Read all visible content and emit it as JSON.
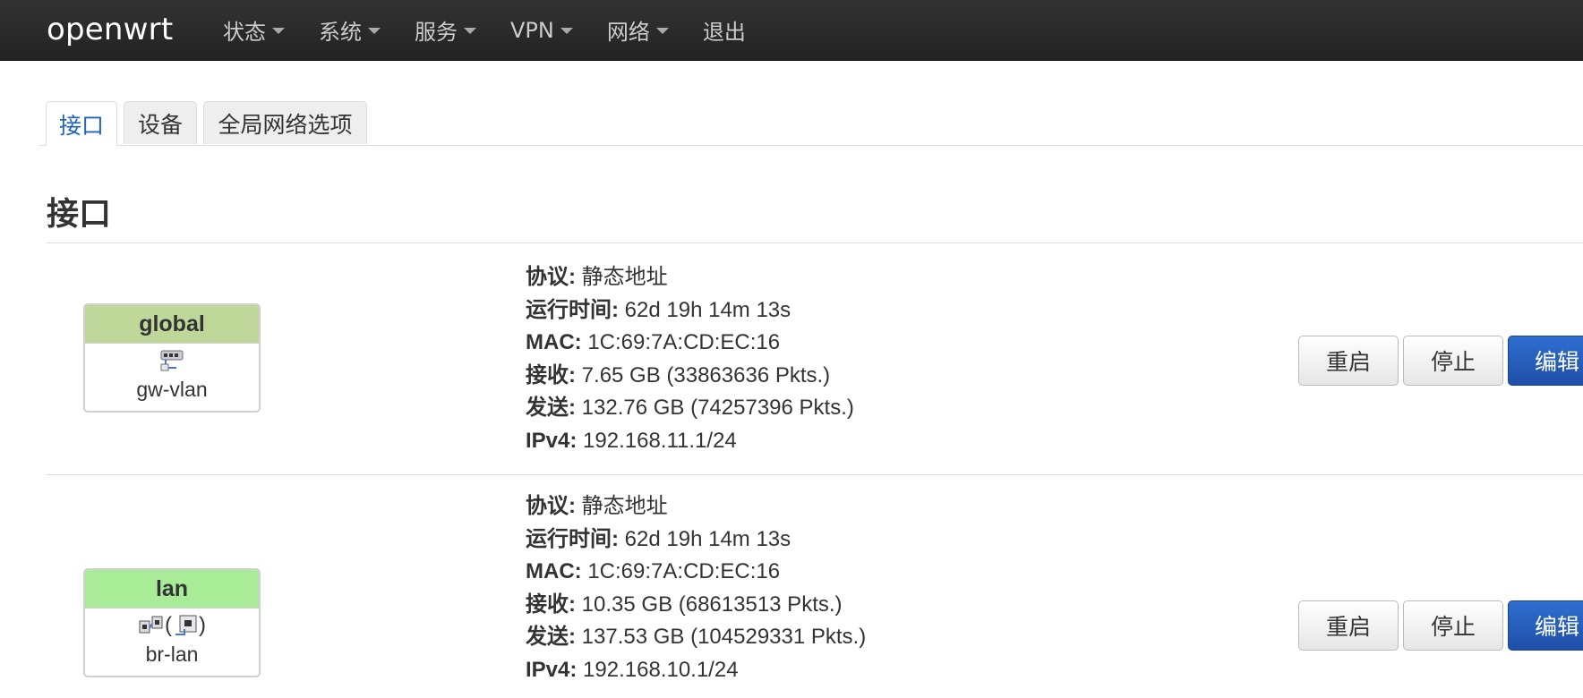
{
  "app": {
    "brand": "openwrt"
  },
  "nav": {
    "items": [
      {
        "label": "状态",
        "dropdown": true
      },
      {
        "label": "系统",
        "dropdown": true
      },
      {
        "label": "服务",
        "dropdown": true
      },
      {
        "label": "VPN",
        "dropdown": true
      },
      {
        "label": "网络",
        "dropdown": true
      },
      {
        "label": "退出",
        "dropdown": false
      }
    ]
  },
  "tabs": [
    {
      "label": "接口",
      "active": true
    },
    {
      "label": "设备",
      "active": false
    },
    {
      "label": "全局网络选项",
      "active": false
    }
  ],
  "section": {
    "title": "接口"
  },
  "interfaces": [
    {
      "name": "global",
      "header_color": "#bfd89a",
      "device": "gw-vlan",
      "icons": [
        "switch-port-icon"
      ],
      "protocol_label": "协议:",
      "protocol": "静态地址",
      "uptime_label": "运行时间:",
      "uptime": "62d 19h 14m 13s",
      "mac_label": "MAC:",
      "mac": "1C:69:7A:CD:EC:16",
      "rx_label": "接收:",
      "rx": "7.65 GB (33863636 Pkts.)",
      "tx_label": "发送:",
      "tx": "132.76 GB (74257396 Pkts.)",
      "ipv4_label": "IPv4:",
      "ipv4": "192.168.11.1/24",
      "buttons": {
        "restart": "重启",
        "stop": "停止",
        "edit": "编辑"
      }
    },
    {
      "name": "lan",
      "header_color": "#a8ec98",
      "device": "br-lan",
      "icons": [
        "bridge-icon",
        "ethernet-port-icon"
      ],
      "icon_open": "(",
      "icon_close": ")",
      "protocol_label": "协议:",
      "protocol": "静态地址",
      "uptime_label": "运行时间:",
      "uptime": "62d 19h 14m 13s",
      "mac_label": "MAC:",
      "mac": "1C:69:7A:CD:EC:16",
      "rx_label": "接收:",
      "rx": "10.35 GB (68613513 Pkts.)",
      "tx_label": "发送:",
      "tx": "137.53 GB (104529331 Pkts.)",
      "ipv4_label": "IPv4:",
      "ipv4": "192.168.10.1/24",
      "buttons": {
        "restart": "重启",
        "stop": "停止",
        "edit": "编辑"
      }
    }
  ]
}
